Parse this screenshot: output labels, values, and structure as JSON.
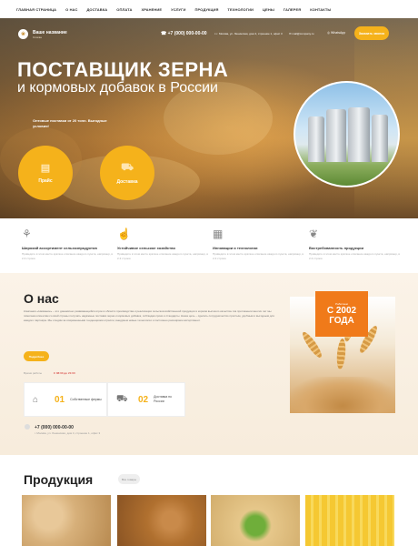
{
  "nav": [
    "Главная страница",
    "О нас",
    "Доставка",
    "Оплата",
    "Хранение",
    "Услуги",
    "Продукция",
    "Технологии",
    "Цены",
    "Галерея",
    "Контакты"
  ],
  "header": {
    "logo_title": "Ваше название",
    "logo_subtitle": "Слоган",
    "phone": "+7 (000) 000-00-00",
    "address": "г. Москва, ул. Ленинская, дом 4, строение 1, офис 3",
    "email": "mail@company.ru",
    "whatsapp": "WhatsApp",
    "callback_button": "Заказать звонок"
  },
  "hero": {
    "title_line1": "ПОСТАВЩИК ЗЕРНА",
    "title_line2": "и кормовых добавок в России",
    "subtitle": "Оптовые поставки от 20 тонн. Выгодные условия!",
    "button_price": "Прайс",
    "button_delivery": "Доставка"
  },
  "features": [
    {
      "icon": "wheat-icon",
      "title": "Широкий ассортимент сельхозпродуктов",
      "text": "Приведите в этом месте краткое описание каждого пункта, например, в 2-3 строки."
    },
    {
      "icon": "thumb-up-icon",
      "title": "Устойчивое сельское хозяйство",
      "text": "Приведите в этом месте краткое описание каждого пункта, например, в 2-3 строки."
    },
    {
      "icon": "grid-icon",
      "title": "Инновации и технологии",
      "text": "Приведите в этом месте краткое описание каждого пункта, например, в 2-3 строки."
    },
    {
      "icon": "sprout-icon",
      "title": "Востребованность продукции",
      "text": "Приведите в этом месте краткое описание каждого пункта, например, в 2-3 строки."
    }
  ],
  "about": {
    "title": "О нас",
    "paragraph": "Компания «Название» – это динамично развивающийся игрок в области производства и реализации сельскохозяйственной продукции и кормов высокого качества. На протяжении многих лет мы помогаем клиентам со всей страны получать надёжные поставки зерна и кормовых добавок, соблюдая сроки и стандарты. Наша цель – сделать сотрудничество простым, удобным и выгодным для каждого партнёра. Мы следим за современными тенденциями отрасли, внедряем новые технологии и постоянно расширяем ассортимент.",
    "more_button": "Подробнее",
    "work_label": "Время работы",
    "work_hours": "С 08:00 до 21:00",
    "stats": [
      {
        "icon": "farm-icon",
        "num": "01",
        "label": "Собственные фермы"
      },
      {
        "icon": "truck-icon",
        "num": "02",
        "label": "Доставка по России"
      }
    ],
    "phone": "+7 (000) 000-00-00",
    "address": "г. Москва, ул. Ленинская, дом 4, строение 1, офис 3",
    "badge_small": "Работаем",
    "badge_big": "С 2002 ГОДА"
  },
  "products": {
    "title": "Продукция",
    "all_button": "Все товары"
  },
  "colors": {
    "accent": "#f5b21b",
    "badge": "#f07a1a"
  }
}
